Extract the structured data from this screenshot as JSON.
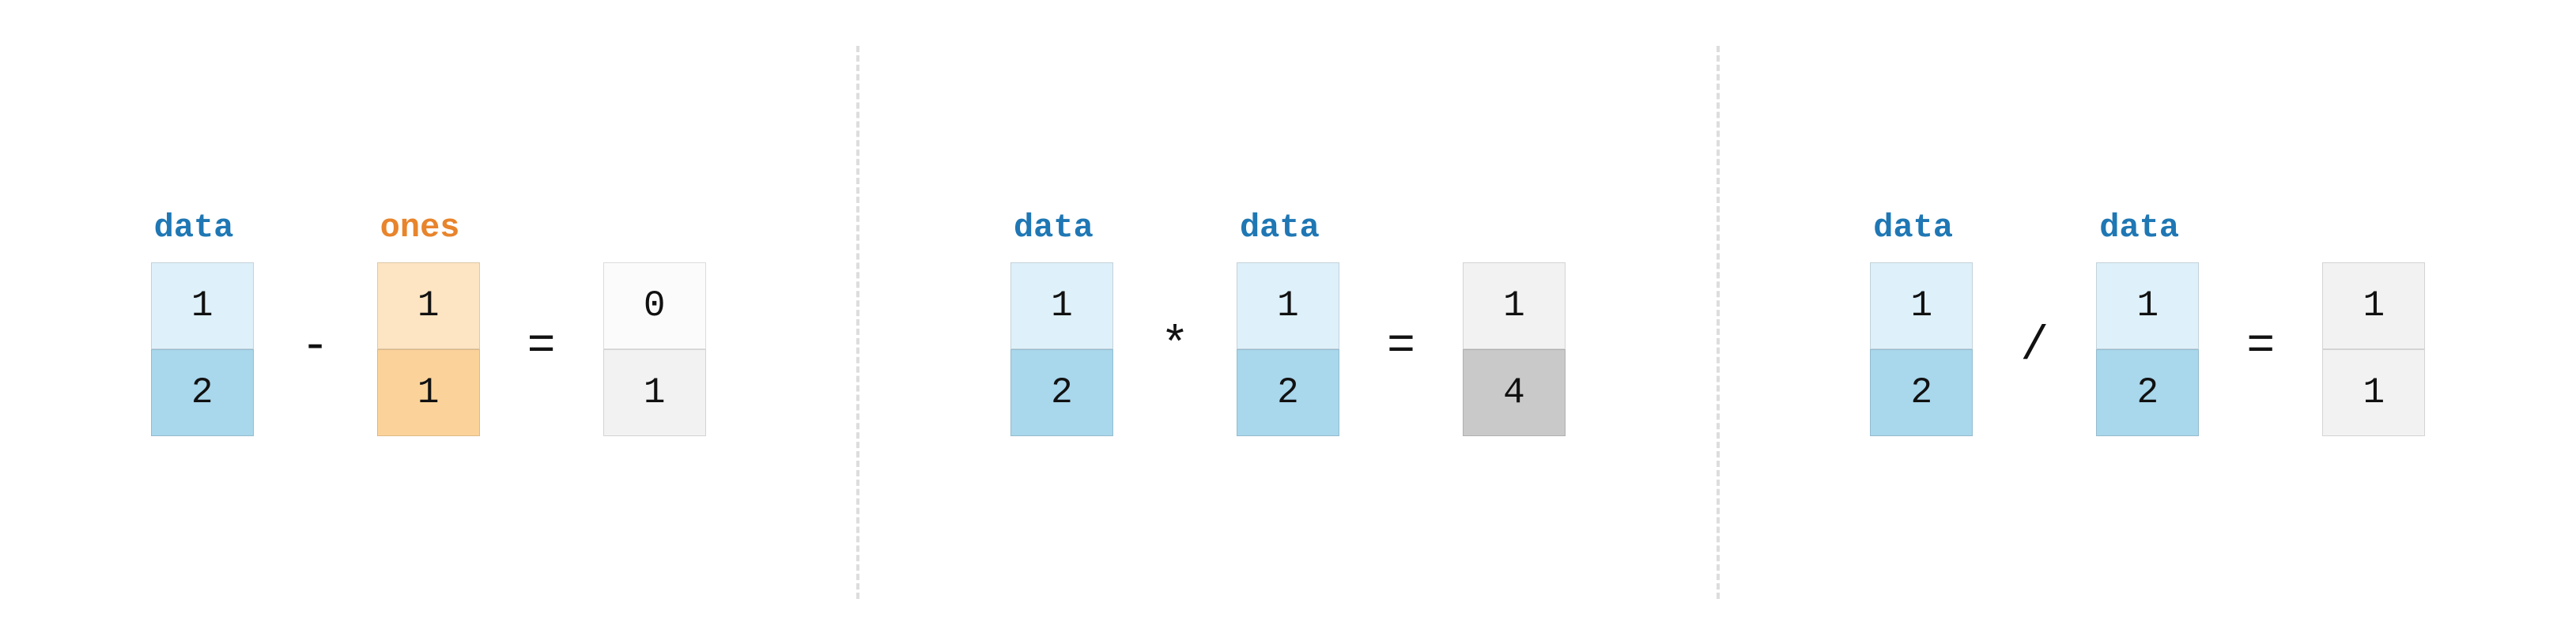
{
  "panels": [
    {
      "left": {
        "label": "data",
        "label_color": "blue",
        "cells": [
          "1",
          "2"
        ],
        "fills": [
          "blue-light",
          "blue-med"
        ]
      },
      "operator": "-",
      "right": {
        "label": "ones",
        "label_color": "orange",
        "cells": [
          "1",
          "1"
        ],
        "fills": [
          "orange-light",
          "orange-med"
        ]
      },
      "equals": "=",
      "result": {
        "cells": [
          "0",
          "1"
        ],
        "fills": [
          "gray-lightest",
          "gray-light"
        ]
      }
    },
    {
      "left": {
        "label": "data",
        "label_color": "blue",
        "cells": [
          "1",
          "2"
        ],
        "fills": [
          "blue-light",
          "blue-med"
        ]
      },
      "operator": "*",
      "right": {
        "label": "data",
        "label_color": "blue",
        "cells": [
          "1",
          "2"
        ],
        "fills": [
          "blue-light",
          "blue-med"
        ]
      },
      "equals": "=",
      "result": {
        "cells": [
          "1",
          "4"
        ],
        "fills": [
          "gray-light",
          "gray-med"
        ]
      }
    },
    {
      "left": {
        "label": "data",
        "label_color": "blue",
        "cells": [
          "1",
          "2"
        ],
        "fills": [
          "blue-light",
          "blue-med"
        ]
      },
      "operator": "/",
      "right": {
        "label": "data",
        "label_color": "blue",
        "cells": [
          "1",
          "2"
        ],
        "fills": [
          "blue-light",
          "blue-med"
        ]
      },
      "equals": "=",
      "result": {
        "cells": [
          "1",
          "1"
        ],
        "fills": [
          "gray-light",
          "gray-light"
        ]
      }
    }
  ],
  "chart_data": {
    "type": "table",
    "description": "Three element-wise array arithmetic diagrams",
    "operations": [
      {
        "op": "subtract",
        "a": [
          1,
          2
        ],
        "b": [
          1,
          1
        ],
        "result": [
          0,
          1
        ]
      },
      {
        "op": "multiply",
        "a": [
          1,
          2
        ],
        "b": [
          1,
          2
        ],
        "result": [
          1,
          4
        ]
      },
      {
        "op": "divide",
        "a": [
          1,
          2
        ],
        "b": [
          1,
          2
        ],
        "result": [
          1,
          1
        ]
      }
    ]
  }
}
